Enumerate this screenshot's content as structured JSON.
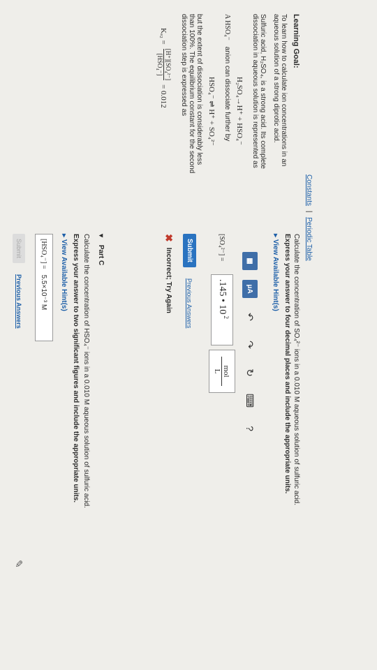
{
  "header": {
    "constants": "Constants",
    "separator": "|",
    "periodic_table": "Periodic Table"
  },
  "left": {
    "learning_goal_title": "Learning Goal:",
    "learning_goal_l1": "To learn how to calculate ion concentrations in an",
    "learning_goal_l2": "aqueous solution of a strong diprotic acid.",
    "sulfuric_l1": "Sulfuric acid, H₂SO₄, is a strong acid. Its complete",
    "sulfuric_l2": "dissociation in aqueous solution is represented as",
    "eq1": "H₂SO₄→H⁺ + HSO₄⁻",
    "hso4_label": "A HSO₄⁻",
    "hso4_text": "anion can dissociate further by",
    "eq2": "HSO₄⁻ ⇌ H⁺ + SO₄²⁻",
    "extent_l1": "but the extent of dissociation is considerably less",
    "extent_l2": "than 100%. The equilibrium constant for the second",
    "extent_l3": "dissociation step is expressed as",
    "ka_label": "Kₐ₂ =",
    "ka_numerator": "[H⁺][SO₄²⁻]",
    "ka_denominator": "[HSO₄⁻]",
    "ka_value": "= 0.012"
  },
  "part_b": {
    "question": "Calculate the concentration of SO₄²⁻ ions in a 0.010 M aqueous solution of sulfuric acid.",
    "instruction": "Express your answer to four decimal places and include the appropriate units.",
    "hints": "View Available Hint(s)",
    "toolbar_mu": "μA",
    "toolbar_help": "?",
    "answer_label": "[SO₄²⁻] =",
    "answer_value": ".145 • 10",
    "answer_exponent": "2",
    "unit_num": "mol",
    "unit_den": "L",
    "submit": "Submit",
    "previous_answers": "Previous Answers",
    "feedback": "Incorrect; Try Again"
  },
  "part_c": {
    "title": "Part C",
    "question": "Calculate the concentration of HSO₄⁻ ions in a 0.010 M aqueous solution of sulfuric acid.",
    "instruction": "Express your answer to two significant figures and include the appropriate units.",
    "hints": "View Available Hint(s)",
    "answer_label": "[HSO₄⁻] =",
    "answer_value": "5.5×10⁻³ M",
    "submit": "Submit",
    "previous_answers": "Previous Answers"
  },
  "colors": {
    "accent": "#2a73c0",
    "link": "#1d5fa8",
    "error": "#c0392b",
    "background": "#efeeea"
  }
}
